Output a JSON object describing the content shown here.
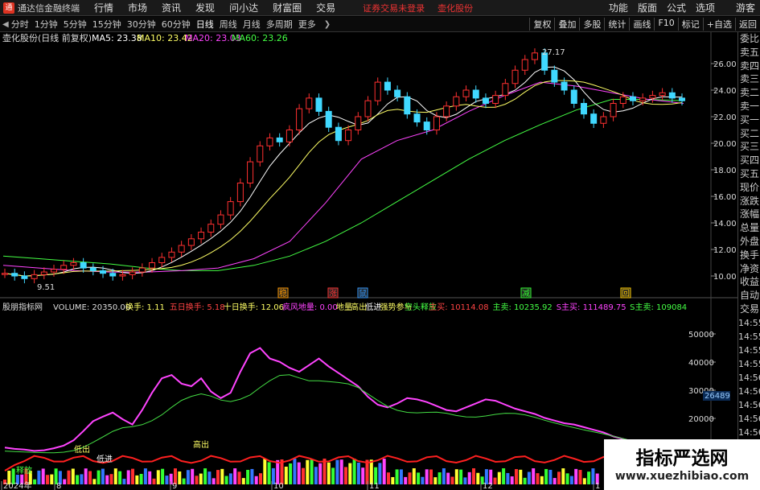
{
  "app": {
    "title": "通达信金融终端",
    "menus": [
      "行情",
      "市场",
      "资讯",
      "发现",
      "问小达",
      "财富圈",
      "交易"
    ],
    "warning": "证券交易未登录",
    "stock_link": "壶化股份",
    "right_menus": [
      "功能",
      "版面",
      "公式",
      "选项"
    ],
    "guest": "游客"
  },
  "tabs": {
    "items": [
      "分时",
      "1分钟",
      "5分钟",
      "15分钟",
      "30分钟",
      "60分钟",
      "日线",
      "周线",
      "月线",
      "多周期",
      "更多"
    ],
    "active": "日线",
    "right": [
      "复权",
      "叠加",
      "多股",
      "统计",
      "画线",
      "F10",
      "标记",
      "+自选",
      "返回"
    ]
  },
  "chart": {
    "stock_label": "壶化股份(日线 前复权)",
    "ma": [
      {
        "label": "MA5: 23.38",
        "color": "#ffffff"
      },
      {
        "label": "MA10: 23.42",
        "color": "#ffff66"
      },
      {
        "label": "MA20: 23.03",
        "color": "#ff44ff"
      },
      {
        "label": "MA60: 23.26",
        "color": "#44ff44"
      }
    ],
    "price_ticks": [
      "26.00",
      "24.00",
      "22.00",
      "20.00",
      "18.00",
      "16.00",
      "14.00",
      "12.00",
      "10.00"
    ],
    "high_label": "27.17",
    "low_label": "9.51",
    "markers": [
      {
        "t": "稳",
        "color": "#ff9900"
      },
      {
        "t": "涨",
        "color": "#ff3333"
      },
      {
        "t": "鼠",
        "color": "#3399ff"
      },
      {
        "t": "减",
        "color": "#33ff33"
      },
      {
        "t": "回",
        "color": "#ffcc00"
      }
    ]
  },
  "indicator": {
    "name": "股朋指标网",
    "volume": "VOLUME: 20350.00",
    "items": [
      {
        "t": "换手: 1.11",
        "c": "#ffff66"
      },
      {
        "t": "五日换手: 5.18",
        "c": "#ff4444"
      },
      {
        "t": "十日换手: 12.06",
        "c": "#ffff66"
      },
      {
        "t": "疯风地量: 0.00",
        "c": "#ff44ff"
      },
      {
        "t": "地量",
        "c": "#ffff66"
      },
      {
        "t": "高出",
        "c": "#ffff66"
      },
      {
        "t": "低进",
        "c": "#ffffff"
      },
      {
        "t": "强势参与",
        "c": "#ffff66"
      },
      {
        "t": "空头释放",
        "c": "#44ff44"
      },
      {
        "t": "主买: 10114.08",
        "c": "#ff4444"
      },
      {
        "t": "主卖: 10235.92",
        "c": "#44ff44"
      },
      {
        "t": "S主买: 111489.75",
        "c": "#ff44ff"
      },
      {
        "t": "S主卖: 109084",
        "c": "#44ff44"
      }
    ],
    "ticks": [
      "50000",
      "40000",
      "30000",
      "20000"
    ],
    "cursor": "26489",
    "months": [
      "2024年",
      "8",
      "9",
      "10",
      "11",
      "12",
      "1"
    ],
    "labels": [
      "低出",
      "低进",
      "高出",
      "释放"
    ]
  },
  "sidebar": {
    "items": [
      "委比",
      "卖五",
      "卖四",
      "卖三",
      "卖二",
      "卖一",
      "买一",
      "买二",
      "买三",
      "买四",
      "买五",
      "现价",
      "涨跌",
      "涨幅",
      "总量",
      "外盘",
      "换手",
      "净资",
      "收益"
    ],
    "bottom": [
      "自动",
      "交易"
    ],
    "times": [
      "14:55",
      "14:55",
      "14:55",
      "14:55",
      "14:56",
      "14:56",
      "14:56",
      "14:56",
      "14:56",
      "14:56",
      "14:56",
      "14:56"
    ]
  },
  "watermark": {
    "name": "指标严选网",
    "url": "www.xuezhibiao.com"
  },
  "chart_data": {
    "type": "line",
    "series": [
      {
        "name": "MA60",
        "values": [
          11.5,
          11.3,
          11.1,
          10.9,
          10.6,
          10.4,
          10.4,
          10.8,
          11.5,
          12.6,
          14.0,
          15.6,
          17.2,
          18.8,
          20.2,
          21.4,
          22.5,
          23.3,
          23.3,
          23.2
        ]
      },
      {
        "name": "MA20",
        "values": [
          10.8,
          10.6,
          10.4,
          10.3,
          10.3,
          10.4,
          10.6,
          11.3,
          12.6,
          15.5,
          18.8,
          20.2,
          21.0,
          22.4,
          23.6,
          24.6,
          24.3,
          23.8,
          23.3,
          23.0
        ]
      }
    ],
    "categories": [
      "2024-07",
      "",
      "",
      "8",
      "",
      "",
      "9",
      "",
      "",
      "10",
      "",
      "",
      "11",
      "",
      "",
      "12",
      "",
      "",
      "1",
      ""
    ],
    "ylim": [
      9,
      27
    ]
  }
}
